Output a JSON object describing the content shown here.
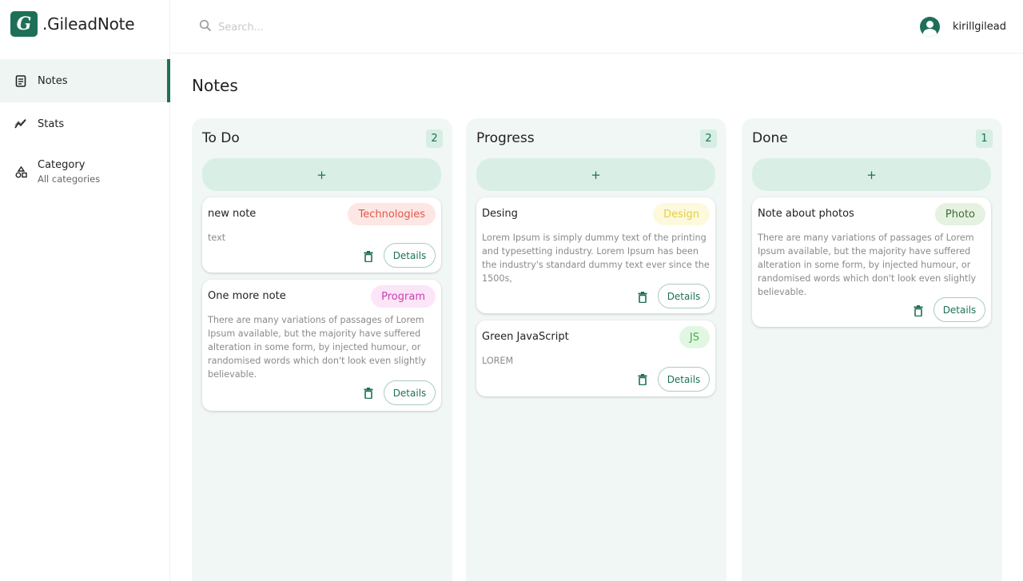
{
  "app": {
    "logo_letter": "G",
    "logo_text": ".GileadNote",
    "accent": "#1d7057"
  },
  "sidebar": {
    "items": [
      {
        "label": "Notes",
        "icon": "notes-icon",
        "active": true
      },
      {
        "label": "Stats",
        "icon": "stats-icon"
      },
      {
        "label": "Category",
        "sub": "All categories",
        "icon": "category-icon"
      }
    ]
  },
  "header": {
    "search_placeholder": "Search...",
    "username": "kirillgilead"
  },
  "page": {
    "title": "Notes"
  },
  "columns": [
    {
      "title": "To Do",
      "count": "2",
      "add_label": "+",
      "cards": [
        {
          "title": "new note",
          "tag": "Technologies",
          "tag_bg": "#fde7e4",
          "tag_color": "#e0574a",
          "text": "text",
          "details": "Details"
        },
        {
          "title": "One more note",
          "tag": "Program",
          "tag_bg": "#fbe5f7",
          "tag_color": "#c940b3",
          "text": "There are many variations of passages of Lorem Ipsum available, but the majority have suffered alteration in some form, by injected humour, or randomised words which don't look even slightly believable.",
          "details": "Details"
        }
      ]
    },
    {
      "title": "Progress",
      "count": "2",
      "add_label": "+",
      "cards": [
        {
          "title": "Desing",
          "tag": "Design",
          "tag_bg": "#fdf9dd",
          "tag_color": "#e4cf4a",
          "text": "Lorem Ipsum is simply dummy text of the printing and typesetting industry. Lorem Ipsum has been the industry's standard dummy text ever since the 1500s,",
          "details": "Details"
        },
        {
          "title": "Green JavaScript",
          "tag": "JS",
          "tag_bg": "#e2f7e2",
          "tag_color": "#3fae49",
          "text": "LOREM",
          "details": "Details"
        }
      ]
    },
    {
      "title": "Done",
      "count": "1",
      "add_label": "+",
      "cards": [
        {
          "title": "Note about photos",
          "tag": "Photo",
          "tag_bg": "#e6f2e1",
          "tag_color": "#3f6b34",
          "text": "There are many variations of passages of Lorem Ipsum available, but the majority have suffered alteration in some form, by injected humour, or randomised words which don't look even slightly believable.",
          "details": "Details"
        }
      ]
    }
  ]
}
